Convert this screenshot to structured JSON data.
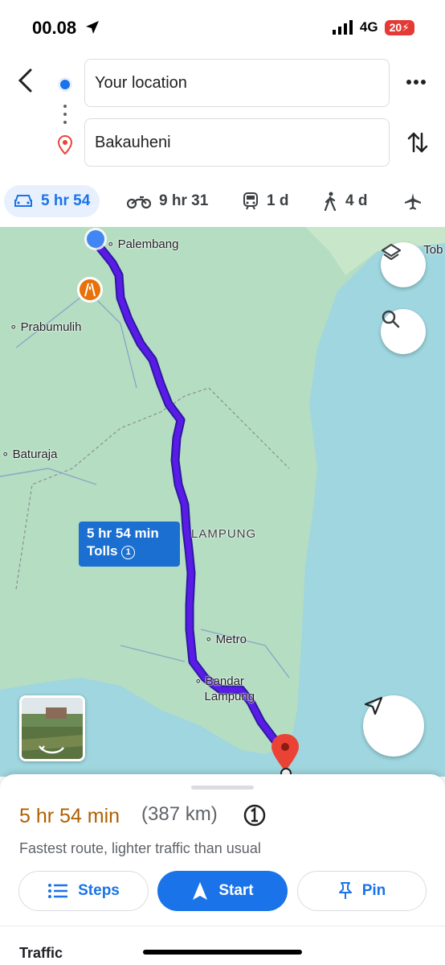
{
  "status_bar": {
    "time": "00.08",
    "network": "4G",
    "battery": "20"
  },
  "search": {
    "origin": "Your location",
    "destination": "Bakauheni"
  },
  "modes": [
    {
      "icon": "car-icon",
      "label": "5 hr 54",
      "active": true
    },
    {
      "icon": "motorcycle-icon",
      "label": "9 hr 31"
    },
    {
      "icon": "transit-icon",
      "label": "1 d"
    },
    {
      "icon": "walk-icon",
      "label": "4 d"
    },
    {
      "icon": "plane-icon",
      "label": ""
    }
  ],
  "map": {
    "places": [
      "Palembang",
      "Prabumulih",
      "Baturaja",
      "LAMPUNG",
      "Metro",
      "Bandar",
      "Lampung",
      "Tob"
    ],
    "route_callout": {
      "time": "5 hr 54 min",
      "tolls": "Tolls"
    }
  },
  "sheet": {
    "duration": "5 hr 54 min",
    "distance": "(387 km)",
    "description": "Fastest route, lighter traffic than usual",
    "steps_label": "Steps",
    "start_label": "Start",
    "pin_label": "Pin",
    "traffic_label": "Traffic"
  },
  "colors": {
    "accent": "#1a73e8",
    "route": "#5a1be8",
    "duration": "#b06000",
    "destination": "#ea4335"
  }
}
